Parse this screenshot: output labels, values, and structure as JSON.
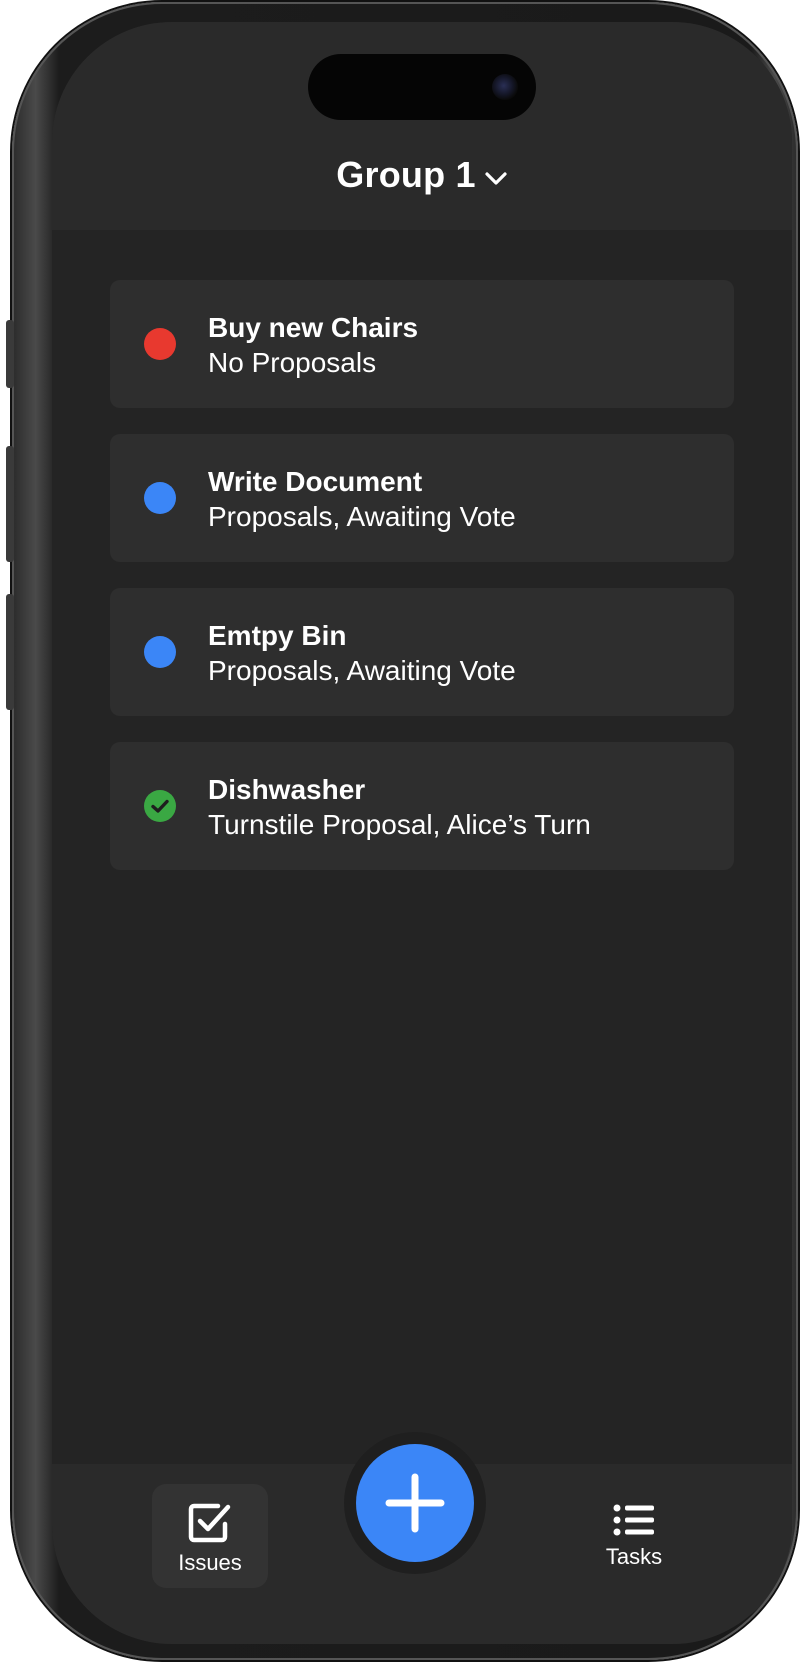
{
  "header": {
    "group_title": "Group 1"
  },
  "issues": [
    {
      "title": "Buy new Chairs",
      "subtitle": "No Proposals",
      "status": "red-dot",
      "color": "#e8392f"
    },
    {
      "title": "Write Document",
      "subtitle": "Proposals, Awaiting Vote",
      "status": "blue-dot",
      "color": "#3b86f7"
    },
    {
      "title": "Emtpy Bin",
      "subtitle": "Proposals, Awaiting Vote",
      "status": "blue-dot",
      "color": "#3b86f7"
    },
    {
      "title": "Dishwasher",
      "subtitle": "Turnstile Proposal, Alice’s Turn",
      "status": "green-check",
      "color": "#3aa843"
    }
  ],
  "tabbar": {
    "issues_label": "Issues",
    "tasks_label": "Tasks"
  },
  "icons": {
    "chevron": "chevron-down-icon",
    "issues": "checkbox-icon",
    "tasks": "list-icon",
    "add": "plus-icon"
  },
  "colors": {
    "background": "#242424",
    "card": "#2e2e2e",
    "accent": "#3b86f7"
  }
}
